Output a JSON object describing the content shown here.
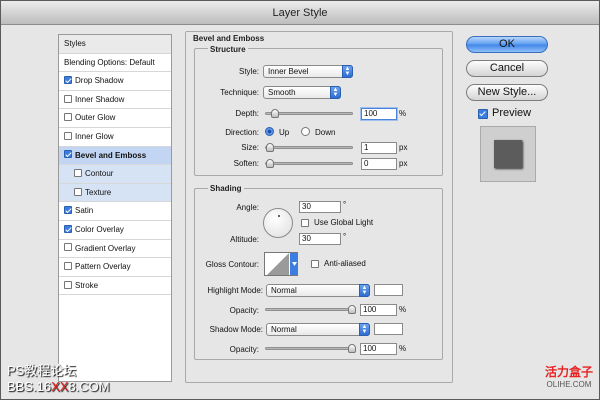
{
  "window": {
    "title": "Layer Style"
  },
  "sidebar": {
    "items": [
      {
        "label": "Styles",
        "checkbox": null
      },
      {
        "label": "Blending Options: Default",
        "checkbox": null
      },
      {
        "label": "Drop Shadow",
        "checkbox": true
      },
      {
        "label": "Inner Shadow",
        "checkbox": false
      },
      {
        "label": "Outer Glow",
        "checkbox": false
      },
      {
        "label": "Inner Glow",
        "checkbox": false
      },
      {
        "label": "Bevel and Emboss",
        "checkbox": true,
        "selected": true
      },
      {
        "label": "Contour",
        "checkbox": false,
        "sub": true
      },
      {
        "label": "Texture",
        "checkbox": false,
        "sub": true
      },
      {
        "label": "Satin",
        "checkbox": true
      },
      {
        "label": "Color Overlay",
        "checkbox": true
      },
      {
        "label": "Gradient Overlay",
        "checkbox": false
      },
      {
        "label": "Pattern Overlay",
        "checkbox": false
      },
      {
        "label": "Stroke",
        "checkbox": false
      }
    ]
  },
  "bevel": {
    "group_title": "Bevel and Emboss",
    "structure_title": "Structure",
    "style_label": "Style:",
    "style_value": "Inner Bevel",
    "technique_label": "Technique:",
    "technique_value": "Smooth",
    "depth_label": "Depth:",
    "depth_value": "100",
    "depth_unit": "%",
    "direction_label": "Direction:",
    "direction_up": "Up",
    "direction_down": "Down",
    "size_label": "Size:",
    "size_value": "1",
    "size_unit": "px",
    "soften_label": "Soften:",
    "soften_value": "0",
    "soften_unit": "px"
  },
  "shading": {
    "title": "Shading",
    "angle_label": "Angle:",
    "angle_value": "30",
    "angle_unit": "°",
    "global_light_label": "Use Global Light",
    "altitude_label": "Altitude:",
    "altitude_value": "30",
    "altitude_unit": "°",
    "gloss_contour_label": "Gloss Contour:",
    "anti_aliased_label": "Anti-aliased",
    "highlight_mode_label": "Highlight Mode:",
    "highlight_mode_value": "Normal",
    "opacity_label": "Opacity:",
    "highlight_opacity_value": "100",
    "opacity_unit": "%",
    "shadow_mode_label": "Shadow Mode:",
    "shadow_mode_value": "Normal",
    "shadow_opacity_value": "100"
  },
  "buttons": {
    "ok": "OK",
    "cancel": "Cancel",
    "new_style": "New Style...",
    "preview": "Preview"
  },
  "watermark": {
    "left_line1": "PS教程论坛",
    "left_line2_a": "BBS.16",
    "left_line2_b": "XX",
    "left_line2_c": "8.COM",
    "right_line1": "活力盒子",
    "right_line2": "OLIHE.COM"
  }
}
